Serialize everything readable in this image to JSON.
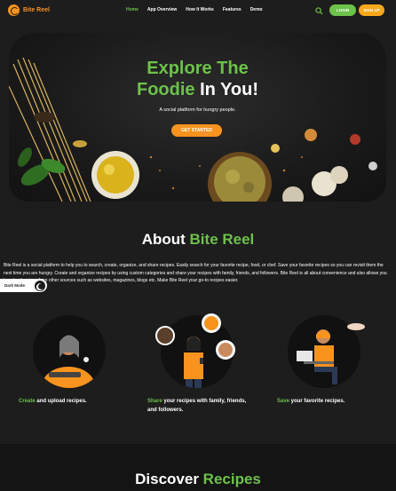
{
  "header": {
    "brand": "Bite Reel",
    "nav": [
      "Home",
      "App Overview",
      "How It Works",
      "Features",
      "Demo"
    ],
    "login": "LOGIN",
    "signup": "SIGN UP"
  },
  "hero": {
    "title_line1": "Explore The",
    "title_line2_green": "Foodie",
    "title_line2_white": " In You!",
    "subtitle": "A social platform for hungry people.",
    "cta": "GET STARTED"
  },
  "about": {
    "title_white": "About ",
    "title_green": "Bite Reel",
    "text": "Bite Reel is a social platform to help you to search, create, organize, and share recipes. Easily search for your favorite recipe, food, or chef. Save your favorite recipes so you can revisit them the next time you are hungry. Create and organize recipes by using custom categories and share your recipes with family, friends, and followers. Bite Reel is all about convenience and also allows you to upload recipes from other sources such as websites, magazines, blogs etc. Make Bite Reel your go-to recipes easier.",
    "dark_mode": "Dark Mode",
    "features": [
      {
        "green": "Create",
        "white": " and upload recipes."
      },
      {
        "green": "Share",
        "white": " your recipes with family, friends, and followers."
      },
      {
        "green": "Save",
        "white": " your favorite recipes."
      }
    ]
  },
  "discover": {
    "title_white": "Discover ",
    "title_green": "Recipes"
  },
  "colors": {
    "accent_green": "#6cc24a",
    "accent_orange": "#f7931e",
    "background": "#1d1d1d"
  }
}
